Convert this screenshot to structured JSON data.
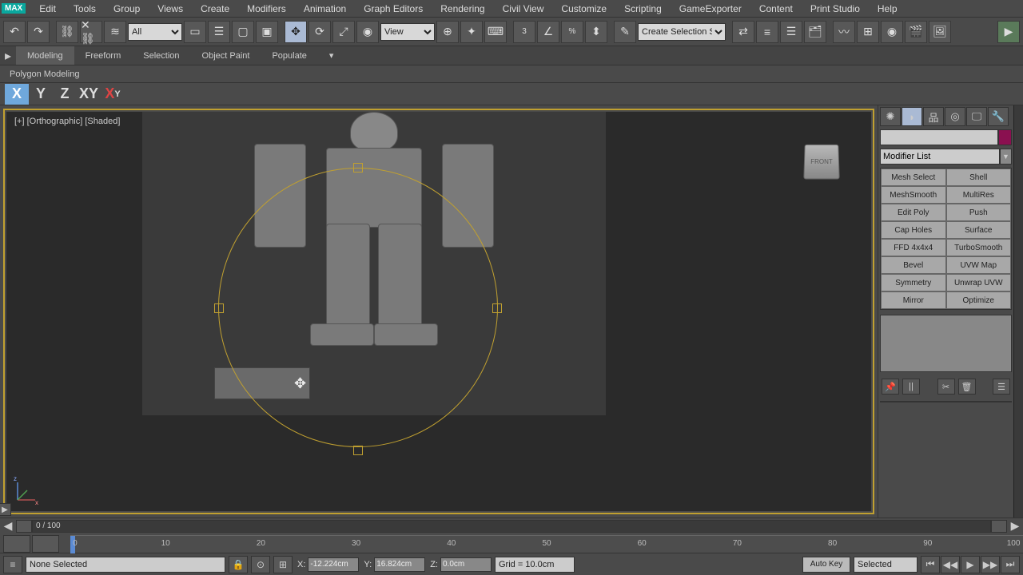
{
  "menu": {
    "logo": "MAX",
    "items": [
      "Edit",
      "Tools",
      "Group",
      "Views",
      "Create",
      "Modifiers",
      "Animation",
      "Graph Editors",
      "Rendering",
      "Civil View",
      "Customize",
      "Scripting",
      "GameExporter",
      "Content",
      "Print Studio",
      "Help"
    ]
  },
  "toolbar": {
    "sel1": "All",
    "sel2": "View",
    "sel3": "Create Selection Se"
  },
  "ribbon": {
    "tabs": [
      "Modeling",
      "Freeform",
      "Selection",
      "Object Paint",
      "Populate"
    ],
    "sub": "Polygon Modeling"
  },
  "axes": [
    "X",
    "Y",
    "Z",
    "XY",
    "XY"
  ],
  "viewport": {
    "label": "[+] [Orthographic] [Shaded]",
    "cube": "FRONT"
  },
  "modifiers": {
    "list_label": "Modifier List",
    "btns": [
      "Mesh Select",
      "Shell",
      "MeshSmooth",
      "MultiRes",
      "Edit Poly",
      "Push",
      "Cap Holes",
      "Surface",
      "FFD 4x4x4",
      "TurboSmooth",
      "Bevel",
      "UVW Map",
      "Symmetry",
      "Unwrap UVW",
      "Mirror",
      "Optimize"
    ]
  },
  "timeline": {
    "pos": "0 / 100",
    "ticks": [
      0,
      10,
      20,
      30,
      40,
      50,
      60,
      70,
      80,
      90,
      100
    ]
  },
  "status": {
    "none": "None Selected",
    "x_lbl": "X:",
    "x_val": "-12.224cm",
    "y_lbl": "Y:",
    "y_val": "16.824cm",
    "z_lbl": "Z:",
    "z_val": "0.0cm",
    "grid": "Grid = 10.0cm",
    "autokey": "Auto Key",
    "selected": "Selected"
  }
}
